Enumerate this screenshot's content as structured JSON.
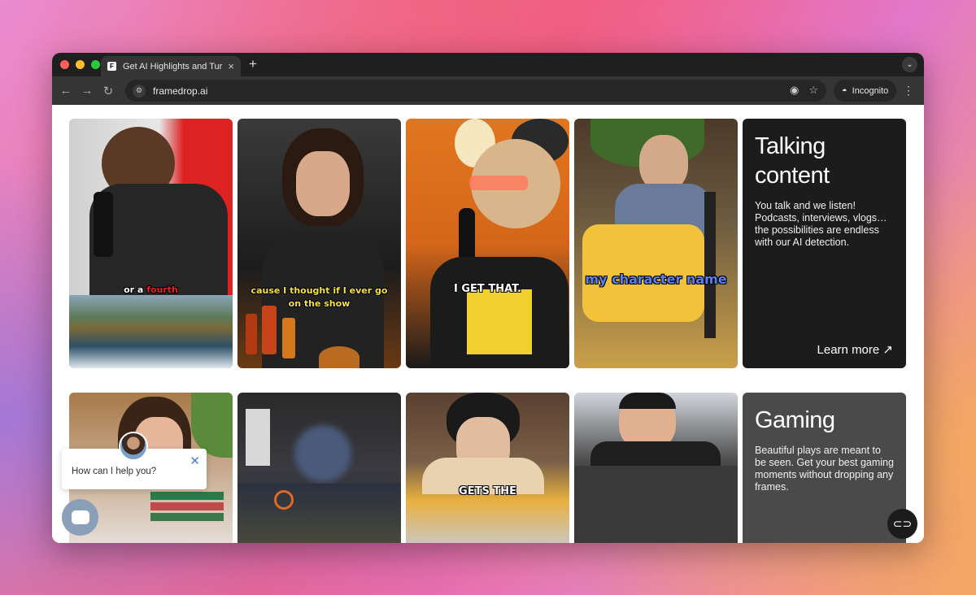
{
  "browser": {
    "tab_title": "Get AI Highlights and Turn Th",
    "favicon": "F",
    "new_tab": "+",
    "tab_menu": "⌄",
    "url": "framedrop.ai",
    "incognito_label": "Incognito"
  },
  "sections": {
    "talking": {
      "heading": "Talking content",
      "body": "You talk and we listen! Podcasts, interviews, vlogs… the possibilities are endless with our AI detection.",
      "link": "Learn more",
      "link_icon": "↗"
    },
    "gaming": {
      "heading": "Gaming",
      "body": "Beautiful plays are meant to be seen. Get your best gaming moments without dropping any frames."
    }
  },
  "captions": {
    "c1_a": "or a ",
    "c1_b": "fourth",
    "c2": "cause I thought if I ever go on the show",
    "c3": "I GET THAT.",
    "c4": "my character name",
    "g3": "GETS THE"
  },
  "chat": {
    "prompt": "How can I help you?",
    "close": "✕"
  },
  "colors": {
    "caption_yellow": "#f5e23a",
    "caption_red": "#e62020",
    "card_dark": "#1c1c1c",
    "card_gray": "#4a4a4a"
  }
}
